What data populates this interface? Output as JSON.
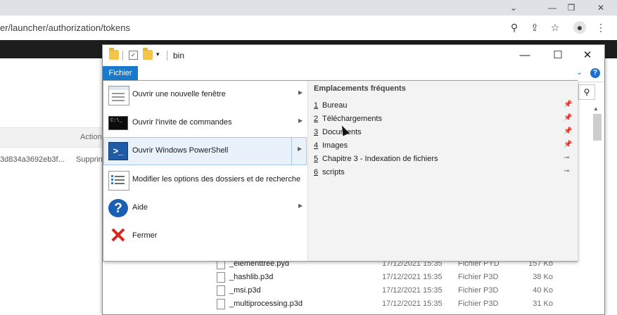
{
  "browser": {
    "address": "er/launcher/authorization/tokens",
    "window_controls": [
      "chevron-down",
      "minimize",
      "restore",
      "close"
    ],
    "toolbar_icons": [
      "zoom-icon",
      "share-icon",
      "star-icon",
      "profile-icon",
      "menu-icon"
    ],
    "table_header": "Action",
    "table_row": {
      "token": "3d834a3692eb3f...",
      "action": "Supprin"
    }
  },
  "explorer": {
    "title": "bin",
    "ribbon_tab": "Fichier",
    "controls": {
      "minimize": "—",
      "maximize": "☐",
      "close": "✕"
    },
    "files": [
      {
        "name": "_elementtree.pyd",
        "date": "17/12/2021 15:35",
        "type": "Fichier PYD",
        "size": "157 Ko"
      },
      {
        "name": "_hashlib.p3d",
        "date": "17/12/2021 15:35",
        "type": "Fichier P3D",
        "size": "38 Ko"
      },
      {
        "name": "_msi.p3d",
        "date": "17/12/2021 15:35",
        "type": "Fichier P3D",
        "size": "40 Ko"
      },
      {
        "name": "_multiprocessing.p3d",
        "date": "17/12/2021 15:35",
        "type": "Fichier P3D",
        "size": "31 Ko"
      }
    ]
  },
  "menu": {
    "items": [
      {
        "label": "Ouvrir une nouvelle fenêtre",
        "icon": "new-window-icon",
        "submenu": true
      },
      {
        "label": "Ouvrir l'invite de commandes",
        "icon": "command-prompt-icon",
        "submenu": true
      },
      {
        "label": "Ouvrir Windows PowerShell",
        "icon": "powershell-icon",
        "submenu": true
      },
      {
        "label": "Modifier les options des dossiers et de recherche",
        "icon": "folder-options-icon",
        "submenu": false
      },
      {
        "label": "Aide",
        "icon": "help-icon",
        "submenu": true
      },
      {
        "label": "Fermer",
        "icon": "close-icon",
        "submenu": false
      }
    ],
    "frequent": {
      "title": "Emplacements fréquents",
      "places": [
        {
          "num": "1",
          "label": "Bureau",
          "pinned": true
        },
        {
          "num": "2",
          "label": "Téléchargements",
          "pinned": true
        },
        {
          "num": "3",
          "label": "Documents",
          "pinned": true
        },
        {
          "num": "4",
          "label": "Images",
          "pinned": true
        },
        {
          "num": "5",
          "label": "Chapitre 3 - Indexation de fichiers",
          "pinned": false
        },
        {
          "num": "6",
          "label": "scripts",
          "pinned": false
        }
      ]
    }
  },
  "colors": {
    "accent": "#1979ca",
    "highlight": "#e9f1fb",
    "close_red": "#d9261c"
  }
}
